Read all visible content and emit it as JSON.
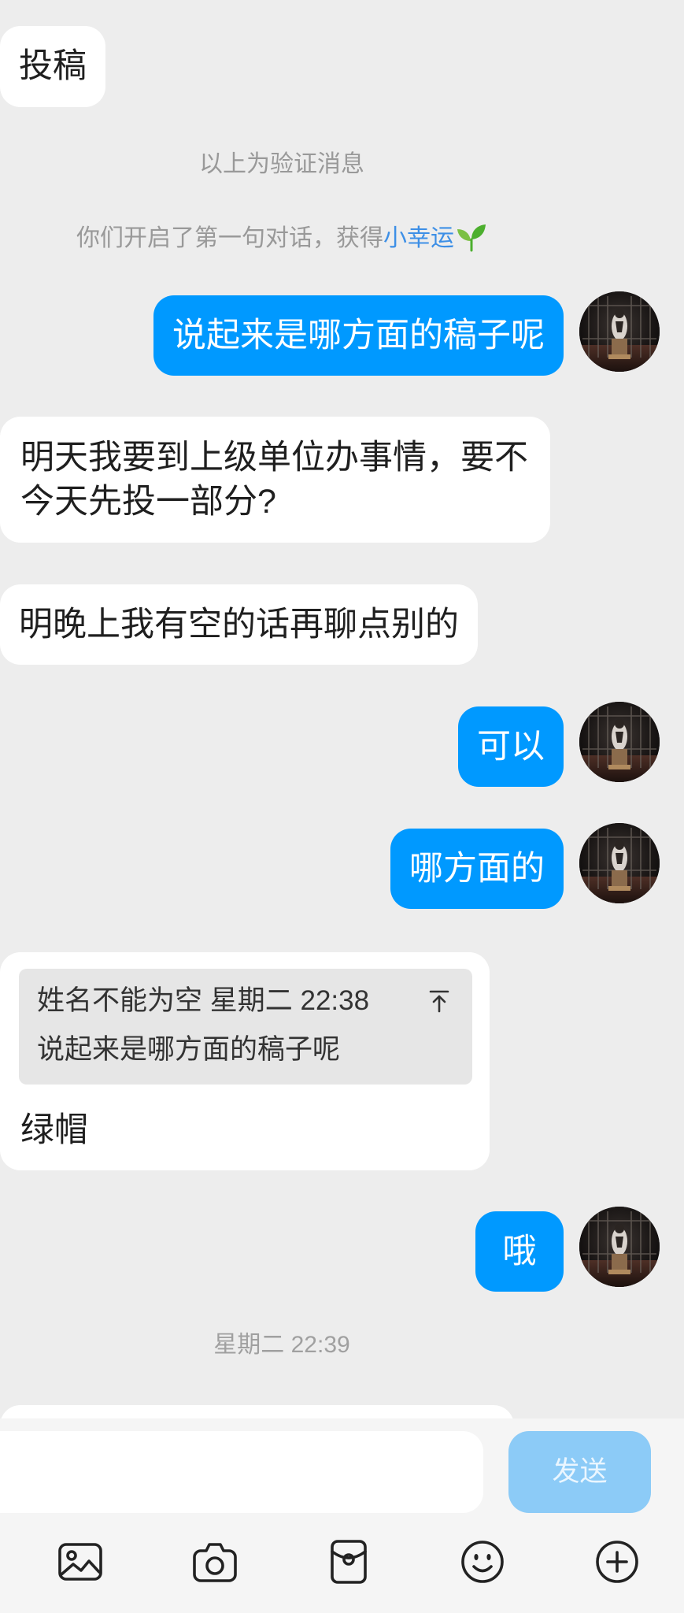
{
  "colors": {
    "bubble_self": "#0099FF",
    "bubble_other": "#FFFFFF",
    "chat_background": "#EDEDED",
    "link": "#3D8FE6",
    "send_button": "#8CCBF7"
  },
  "notices": {
    "verification": "以上为验证消息",
    "first_chat_prefix": "你们开启了第一句对话，获得",
    "first_chat_link": "小幸运",
    "first_chat_icon": "sprout-icon"
  },
  "messages": [
    {
      "outgoing": false,
      "text": "投稿"
    },
    {
      "outgoing": true,
      "text": "说起来是哪方面的稿子呢"
    },
    {
      "outgoing": false,
      "text": "明天我要到上级单位办事情，要不今天先投一部分?"
    },
    {
      "outgoing": false,
      "text": "明晚上我有空的话再聊点别的"
    },
    {
      "outgoing": true,
      "text": "可以"
    },
    {
      "outgoing": true,
      "text": "哪方面的"
    },
    {
      "outgoing": false,
      "quote": {
        "author": "姓名不能为空",
        "time": "星期二 22:38",
        "text": "说起来是哪方面的稿子呢",
        "icon": "jump-to-original-icon"
      },
      "text": "绿帽"
    },
    {
      "outgoing": true,
      "text": "哦"
    }
  ],
  "timestamp": "星期二 22:39",
  "composer": {
    "input_value": "",
    "send_label": "发送"
  },
  "toolbar": [
    {
      "icon": "image-icon"
    },
    {
      "icon": "camera-icon"
    },
    {
      "icon": "red-packet-icon"
    },
    {
      "icon": "emoji-icon"
    },
    {
      "icon": "plus-icon"
    }
  ]
}
